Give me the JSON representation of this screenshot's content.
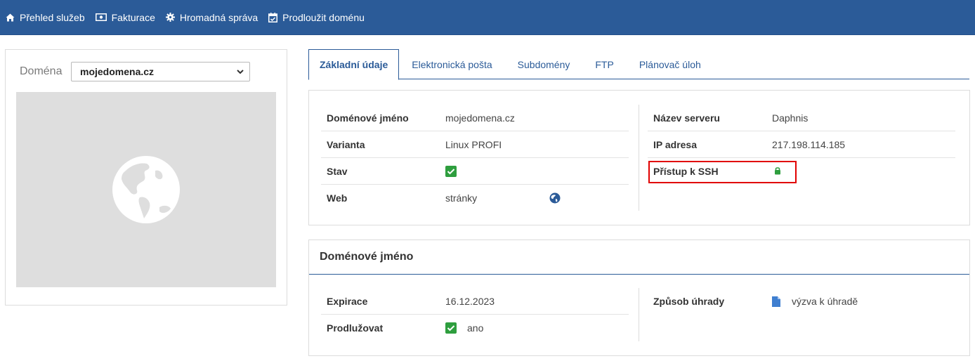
{
  "nav": [
    {
      "label": "Přehled služeb",
      "icon": "home-icon"
    },
    {
      "label": "Fakturace",
      "icon": "money-icon"
    },
    {
      "label": "Hromadná správa",
      "icon": "gear-icon"
    },
    {
      "label": "Prodloužit doménu",
      "icon": "calendar-check-icon"
    }
  ],
  "left": {
    "domain_label": "Doména",
    "selected_domain": "mojedomena.cz"
  },
  "tabs": [
    {
      "label": "Základní údaje",
      "active": true
    },
    {
      "label": "Elektronická pošta",
      "active": false
    },
    {
      "label": "Subdomény",
      "active": false
    },
    {
      "label": "FTP",
      "active": false
    },
    {
      "label": "Plánovač úloh",
      "active": false
    }
  ],
  "basic": {
    "left": [
      {
        "label": "Doménové jméno",
        "value": "mojedomena.cz"
      },
      {
        "label": "Varianta",
        "value": "Linux PROFI"
      },
      {
        "label": "Stav",
        "value": ""
      },
      {
        "label": "Web",
        "value": "stránky"
      }
    ],
    "right": [
      {
        "label": "Název serveru",
        "value": "Daphnis"
      },
      {
        "label": "IP adresa",
        "value": "217.198.114.185"
      },
      {
        "label": "Přístup k SSH",
        "value": ""
      }
    ]
  },
  "domain_card": {
    "title": "Doménové jméno",
    "left": [
      {
        "label": "Expirace",
        "value": "16.12.2023"
      },
      {
        "label": "Prodlužovat",
        "value": "ano"
      }
    ],
    "right": [
      {
        "label": "Způsob úhrady",
        "value": "výzva k úhradě"
      }
    ]
  },
  "colors": {
    "brand": "#2b5b98",
    "ok": "#2e9e3e",
    "highlight": "#e10000"
  }
}
